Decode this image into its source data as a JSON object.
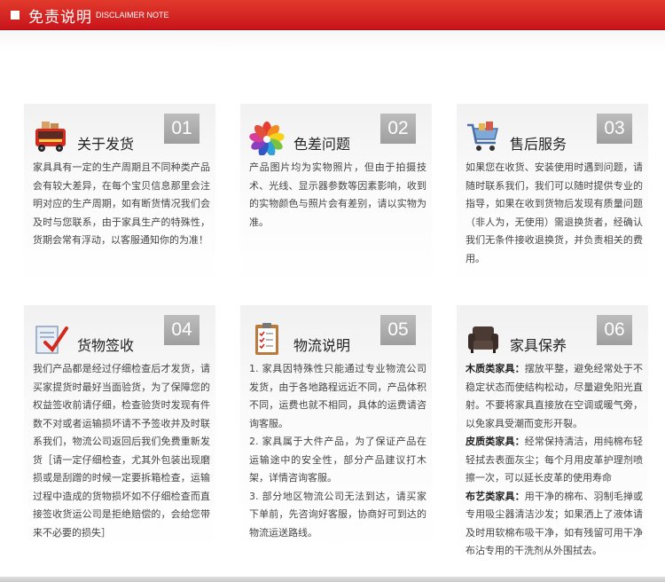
{
  "header": {
    "title": "免责说明",
    "subtitle": "DISCLAIMER NOTE"
  },
  "cards": [
    {
      "num": "01",
      "title": "关于发货",
      "icon": "delivery-truck-icon",
      "desc": "家具具有一定的生产周期且不同种类产品会有较大差异，在每个宝贝信息那里会注明对应的生产周期，如有断货情况我们会及时与您联系，由于家具生产的特殊性，货期会常有浮动，以客服通知你的为准！"
    },
    {
      "num": "02",
      "title": "色差问题",
      "icon": "color-palette-icon",
      "desc": "产品图片均为实物照片，但由于拍摄技术、光线、显示器参数等因素影响，收到的实物颜色与照片会有差别，请以实物为准。"
    },
    {
      "num": "03",
      "title": "售后服务",
      "icon": "shopping-cart-icon",
      "desc": "如果您在收货、安装使用时遇到问题，请随时联系我们，我们可以随时提供专业的指导，如果在收到货物后发现有质量问题（非人为，无使用）需退换货者，经确认我们无条件接收退换货，并负责相关的费用。"
    },
    {
      "num": "04",
      "title": "货物签收",
      "icon": "signature-check-icon",
      "desc": "我们产品都是经过仔细检查后才发货，请买家提货时最好当面验货，为了保障您的权益签收前请仔细，检查验货时发现有件数不对或者运输损坏请不予签收并及时联系我们，物流公司返回后我们免费重新发货［请一定仔细检查，尤其外包装出现磨损或是刮蹭的时候一定要拆箱检查，运输过程中造成的货物损坏如不仔细检查而直接签收货运公司是拒绝赔偿的，会给您带来不必要的损失］"
    },
    {
      "num": "05",
      "title": "物流说明",
      "icon": "clipboard-checklist-icon",
      "paras": [
        "1. 家具因特殊性只能通过专业物流公司发货，由于各地路程远近不同，产品体积不同，运费也就不相同，具体的运费请咨询客服。",
        "2. 家具属于大件产品，为了保证产品在运输途中的安全性，部分产品建议打木架，详情咨询客服。",
        "3. 部分地区物流公司无法到达，请买家下单前，先咨询好客服，协商好可到达的物流运送路线。"
      ]
    },
    {
      "num": "06",
      "title": "家具保养",
      "icon": "armchair-icon",
      "care": [
        {
          "label": "木质类家具：",
          "text": "摆放平整，避免经常处于不稳定状态而使结构松动，尽量避免阳光直射。不要将家具直接放在空调或暖气旁，以免家具受潮而变形开裂。"
        },
        {
          "label": "皮质类家具：",
          "text": "经常保持清洁，用纯棉布轻轻拭去表面灰尘；每个月用皮革护理剂喷擦一次，可以延长皮革的使用寿命"
        },
        {
          "label": "布艺类家具：",
          "text": "用干净的棉布、羽制毛掸或专用吸尘器清洁沙发；如果洒上了液体请及时用软棉布吸干净，如有残留可用干净布沾专用的干洗剂从外围拭去。"
        }
      ]
    }
  ]
}
